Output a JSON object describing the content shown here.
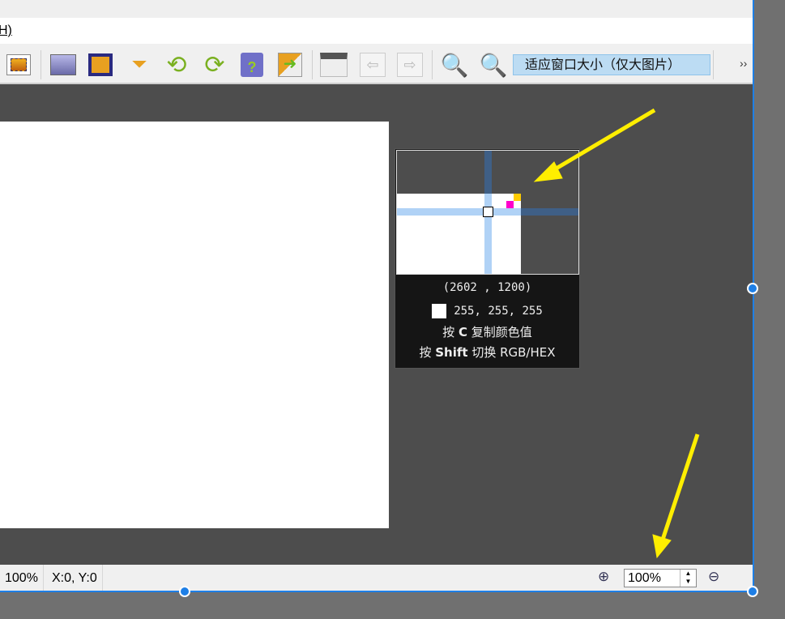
{
  "menubar": {
    "partial_item": "H)"
  },
  "toolbar": {
    "icons": [
      "image-frame-icon",
      "image-icon",
      "crop-icon",
      "image-filter-icon",
      "rotate-left-icon",
      "rotate-right-icon",
      "save-as-icon",
      "export-image-icon",
      "slideshow-icon",
      "previous-icon",
      "next-icon",
      "lock-zoom-icon",
      "actual-size-icon"
    ],
    "fit_mode_label": "适应窗口大小（仅大图片）",
    "more_label": "››"
  },
  "magnifier": {
    "coords": "(2602 , 1200)",
    "rgb": "255, 255, 255",
    "swatch_color": "#ffffff",
    "hint_copy_prefix": "按 ",
    "hint_copy_key": "C",
    "hint_copy_suffix": " 复制颜色值",
    "hint_toggle_prefix": "按 ",
    "hint_toggle_key": "Shift",
    "hint_toggle_suffix": " 切换 RGB/HEX"
  },
  "statusbar": {
    "zoom": "100%",
    "position": "X:0, Y:0",
    "zoom_field": "100%"
  },
  "colors": {
    "accent": "#1e7fe6",
    "arrow": "#ffee00",
    "canvas": "#4d4d4d"
  }
}
